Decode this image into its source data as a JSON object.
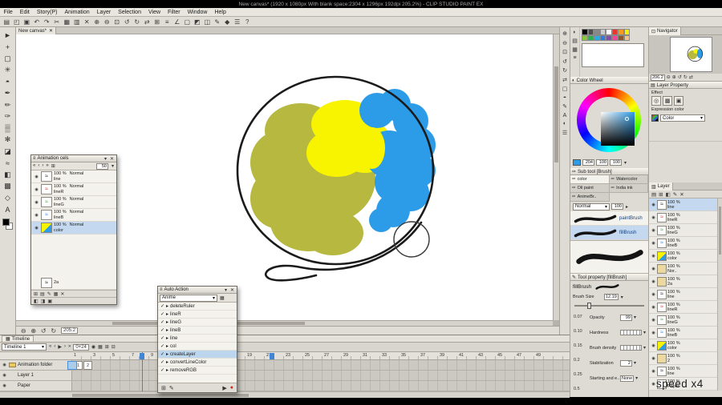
{
  "window": {
    "title": "New canvas* (1920 x 1080px With blank space:2304 x 1296px 192dpi 205.2%) - CLIP STUDIO PAINT EX"
  },
  "colors": {
    "olive": "#b6b83f",
    "yellow": "#f8f400",
    "blue": "#2d9ce8",
    "selection_blue": "#bcd6ee",
    "marker_blue": "#3f86d8"
  },
  "menubar": {
    "items": [
      {
        "label": "File"
      },
      {
        "label": "Edit"
      },
      {
        "label": "Story(P)"
      },
      {
        "label": "Animation"
      },
      {
        "label": "Layer"
      },
      {
        "label": "Selection"
      },
      {
        "label": "View"
      },
      {
        "label": "Filter"
      },
      {
        "label": "Window"
      },
      {
        "label": "Help"
      }
    ]
  },
  "toolbar": {
    "icons": [
      {
        "name": "new-canvas-icon",
        "glyph": "▤"
      },
      {
        "name": "open-icon",
        "glyph": "◰"
      },
      {
        "name": "save-icon",
        "glyph": "▣"
      },
      {
        "name": "undo-icon",
        "glyph": "↶"
      },
      {
        "name": "redo-icon",
        "glyph": "↷"
      },
      {
        "name": "cut-icon",
        "glyph": "✂"
      },
      {
        "name": "copy-icon",
        "glyph": "▦"
      },
      {
        "name": "paste-icon",
        "glyph": "▥"
      },
      {
        "name": "delete-icon",
        "glyph": "✕"
      },
      {
        "name": "zoom-in-icon",
        "glyph": "⊕"
      },
      {
        "name": "zoom-out-icon",
        "glyph": "⊖"
      },
      {
        "name": "fit-screen-icon",
        "glyph": "⊡"
      },
      {
        "name": "rotate-left-icon",
        "glyph": "↺"
      },
      {
        "name": "rotate-right-icon",
        "glyph": "↻"
      },
      {
        "name": "flip-horizontal-icon",
        "glyph": "⇄"
      },
      {
        "name": "grid-icon",
        "glyph": "⊞"
      },
      {
        "name": "snap-ruler-icon",
        "glyph": "≡"
      },
      {
        "name": "snap-special-ruler-icon",
        "glyph": "∠"
      },
      {
        "name": "select-none-icon",
        "glyph": "▢"
      },
      {
        "name": "invert-selection-icon",
        "glyph": "◩"
      },
      {
        "name": "selection-border-icon",
        "glyph": "◫"
      },
      {
        "name": "pen-settings-icon",
        "glyph": "✎"
      },
      {
        "name": "material-icon",
        "glyph": "◆"
      },
      {
        "name": "launcher-icon",
        "glyph": "☰"
      },
      {
        "name": "help-icon",
        "glyph": "?"
      }
    ]
  },
  "tools": {
    "items": [
      {
        "name": "operation-tool-icon",
        "glyph": "►"
      },
      {
        "name": "move-tool-icon",
        "glyph": "+"
      },
      {
        "name": "marquee-tool-icon",
        "glyph": "▢"
      },
      {
        "name": "auto-select-tool-icon",
        "glyph": "✳"
      },
      {
        "name": "eyedropper-tool-icon",
        "glyph": "◓"
      },
      {
        "name": "pen-tool-icon",
        "glyph": "✒"
      },
      {
        "name": "pencil-tool-icon",
        "glyph": "✏"
      },
      {
        "name": "brush-tool-icon",
        "glyph": "✑"
      },
      {
        "name": "airbrush-tool-icon",
        "glyph": "▒"
      },
      {
        "name": "decoration-tool-icon",
        "glyph": "✻"
      },
      {
        "name": "eraser-tool-icon",
        "glyph": "◪"
      },
      {
        "name": "blend-tool-icon",
        "glyph": "≈"
      },
      {
        "name": "fill-tool-icon",
        "glyph": "◧"
      },
      {
        "name": "gradient-tool-icon",
        "glyph": "▩"
      },
      {
        "name": "figure-tool-icon",
        "glyph": "◇"
      },
      {
        "name": "text-tool-icon",
        "glyph": "A"
      }
    ]
  },
  "side_tools": {
    "items": [
      {
        "name": "zoom-in-icon",
        "glyph": "⊕"
      },
      {
        "name": "zoom-out-icon",
        "glyph": "⊖"
      },
      {
        "name": "fit-icon",
        "glyph": "⊡"
      },
      {
        "name": "rotate-ccw-icon",
        "glyph": "↺"
      },
      {
        "name": "rotate-cw-icon",
        "glyph": "↻"
      },
      {
        "name": "flip-icon",
        "glyph": "⇄"
      },
      {
        "name": "reset-view-icon",
        "glyph": "▢"
      },
      {
        "name": "eyedropper-icon",
        "glyph": "◓"
      },
      {
        "name": "pen-icon",
        "glyph": "✎"
      },
      {
        "name": "text-icon",
        "glyph": "A"
      },
      {
        "name": "tone-icon",
        "glyph": "◐"
      },
      {
        "name": "menu-icon",
        "glyph": "☰"
      }
    ]
  },
  "canvas": {
    "tab_label": "New canvas*",
    "close": "✕",
    "status_zoom": "205.2",
    "status_icons": [
      {
        "name": "zoom-out-icon",
        "glyph": "⊖"
      },
      {
        "name": "zoom-in-icon",
        "glyph": "⊕"
      },
      {
        "name": "rotate-ccw-icon",
        "glyph": "↺"
      },
      {
        "name": "rotate-cw-icon",
        "glyph": "↻"
      }
    ]
  },
  "swatches": {
    "side_icons": [
      {
        "name": "color-wheel-icon",
        "glyph": "◐"
      },
      {
        "name": "color-set-icon",
        "glyph": "▤"
      },
      {
        "name": "mixing-icon",
        "glyph": "▦"
      },
      {
        "name": "history-icon",
        "glyph": "≡"
      }
    ],
    "colors": [
      "#000000",
      "#4d4d4d",
      "#888888",
      "#cccccc",
      "#ffffff",
      "#e8372c",
      "#f59b22",
      "#f6ef0c",
      "#8bc53f",
      "#2bb24c",
      "#29abe2",
      "#2b7de0",
      "#7b52a8",
      "#ed4996",
      "#8b5a2b",
      "#f2c28c"
    ]
  },
  "color_wheel": {
    "title": "Color Wheel"
  },
  "color_values": {
    "values": [
      "204",
      "100",
      "100"
    ]
  },
  "sub_tool": {
    "title": "Sub tool [Brush]",
    "tabs": [
      {
        "label": "color",
        "active": true
      },
      {
        "label": "Watercolor"
      },
      {
        "label": "Oil paint"
      },
      {
        "label": "India ink"
      },
      {
        "label": "AnimeBr.."
      }
    ]
  },
  "blend": {
    "mode": "Normal",
    "value": "100"
  },
  "brushes": {
    "items": [
      {
        "name": "paintBrush"
      },
      {
        "name": "fillBrush",
        "selected": true
      }
    ]
  },
  "tool_property": {
    "title": "Tool property [fillBrush]",
    "brush_name": "fillBrush",
    "brush_size": {
      "label": "Brush Size",
      "value": "12.19"
    },
    "mini_values": [
      "0.07",
      "0.10",
      "0.15",
      "0.2",
      "0.25",
      "0.5"
    ],
    "params": [
      {
        "label": "Opacity",
        "value": "99"
      },
      {
        "label": "Hardness",
        "value": "",
        "seg": true
      },
      {
        "label": "Brush density",
        "value": "",
        "seg": true
      },
      {
        "label": "Stabilization",
        "value": "2"
      },
      {
        "label": "Starting and e..",
        "value": "None"
      }
    ]
  },
  "navigator": {
    "title": "Navigator",
    "zoom": "206.2",
    "icons": [
      {
        "name": "zoom-out-icon",
        "glyph": "⊖"
      },
      {
        "name": "zoom-in-icon",
        "glyph": "⊕"
      },
      {
        "name": "rotate-ccw-icon",
        "glyph": "↺"
      },
      {
        "name": "rotate-cw-icon",
        "glyph": "↻"
      },
      {
        "name": "flip-icon",
        "glyph": "⇄"
      }
    ]
  },
  "layer_property": {
    "title": "Layer Property",
    "effect_label": "Effect",
    "effect_icons": [
      {
        "name": "border-effect-icon",
        "glyph": "◎"
      },
      {
        "name": "tone-effect-icon",
        "glyph": "▩"
      },
      {
        "name": "layer-color-effect-icon",
        "glyph": "▣"
      }
    ],
    "expression_label": "Expression color",
    "expression_value": "Color"
  },
  "layer_panel": {
    "tab": "Layer",
    "icons": [
      {
        "name": "new-layer-icon",
        "glyph": "▤"
      },
      {
        "name": "new-folder-icon",
        "glyph": "⊞"
      },
      {
        "name": "mask-icon",
        "glyph": "◧"
      },
      {
        "name": "edit-icon",
        "glyph": "✎"
      },
      {
        "name": "delete-layer-icon",
        "glyph": "✕"
      }
    ],
    "rows": [
      {
        "opacity": "100 %",
        "name": "line",
        "kind": "k",
        "selected": true
      },
      {
        "opacity": "100 %",
        "name": "lineR",
        "kind": "r"
      },
      {
        "opacity": "100 %",
        "name": "lineG",
        "kind": "g"
      },
      {
        "opacity": "100 %",
        "name": "lineB",
        "kind": "b"
      },
      {
        "opacity": "100 %",
        "name": "color",
        "kind": "c"
      },
      {
        "opacity": "100 %",
        "name": "Nor..",
        "kind": "f"
      },
      {
        "opacity": "100 %",
        "name": "2a",
        "kind": "f"
      },
      {
        "opacity": "100 %",
        "name": "line",
        "kind": "k"
      },
      {
        "opacity": "100 %",
        "name": "lineR",
        "kind": "r"
      },
      {
        "opacity": "100 %",
        "name": "lineG",
        "kind": "g"
      },
      {
        "opacity": "100 %",
        "name": "lineB",
        "kind": "b"
      },
      {
        "opacity": "100 %",
        "name": "color",
        "kind": "c"
      },
      {
        "opacity": "100 %",
        "name": "2",
        "kind": "f"
      },
      {
        "opacity": "100 %",
        "name": "line",
        "kind": "k"
      },
      {
        "opacity": "100 %",
        "name": "Paper",
        "kind": "w"
      }
    ]
  },
  "animation_cels": {
    "title": "Animation cels",
    "toolbar_icons": [
      {
        "name": "prev-cel-icon",
        "glyph": "«"
      },
      {
        "name": "prev-icon",
        "glyph": "‹"
      },
      {
        "name": "next-icon",
        "glyph": "›"
      },
      {
        "name": "next-cel-icon",
        "glyph": "»"
      },
      {
        "name": "light-table-icon",
        "glyph": "⊞"
      }
    ],
    "value": "50",
    "rows": [
      {
        "opacity": "100 %",
        "mode": "Normal",
        "name": "line",
        "kind": "k"
      },
      {
        "opacity": "100 %",
        "mode": "Normal",
        "name": "lineR",
        "kind": "r"
      },
      {
        "opacity": "100 %",
        "mode": "Normal",
        "name": "lineG",
        "kind": "g"
      },
      {
        "opacity": "100 %",
        "mode": "Normal",
        "name": "lineB",
        "kind": "b"
      },
      {
        "opacity": "100 %",
        "mode": "Normal",
        "name": "color",
        "kind": "c",
        "selected": true
      }
    ],
    "extra_row": {
      "name": "2a"
    },
    "footer_icons": [
      {
        "name": "register-cel-icon",
        "glyph": "⊞"
      },
      {
        "name": "new-cel-icon",
        "glyph": "▤"
      },
      {
        "name": "edit-cel-icon",
        "glyph": "✎"
      },
      {
        "name": "cel-settings-icon",
        "glyph": "▦"
      },
      {
        "name": "delete-cel-icon",
        "glyph": "✕"
      }
    ],
    "footer_icons2": [
      {
        "name": "onion-prev-icon",
        "glyph": "◧"
      },
      {
        "name": "onion-next-icon",
        "glyph": "◨"
      },
      {
        "name": "onion-settings-icon",
        "glyph": "▣"
      }
    ]
  },
  "auto_action": {
    "title": "Auto Action",
    "set_name": "Anime",
    "rows": [
      {
        "name": "deleteRuler"
      },
      {
        "name": "lineR"
      },
      {
        "name": "lineG"
      },
      {
        "name": "lineB"
      },
      {
        "name": "line"
      },
      {
        "name": "col"
      },
      {
        "name": "createLayer",
        "selected": true
      },
      {
        "name": "convertLineColor"
      },
      {
        "name": "removeRGB"
      }
    ],
    "footer_left": [
      {
        "name": "add-action-icon",
        "glyph": "⊞"
      },
      {
        "name": "record-settings-icon",
        "glyph": "✎"
      }
    ],
    "footer_right": [
      {
        "name": "play-action-icon",
        "glyph": "▶"
      },
      {
        "name": "record-action-icon",
        "glyph": "●",
        "red": true
      }
    ]
  },
  "timeline": {
    "tab": "Timeline",
    "name": "Timeline 1",
    "frame_label": "0+24",
    "transport": [
      {
        "name": "go-start-icon",
        "glyph": "«"
      },
      {
        "name": "prev-frame-icon",
        "glyph": "‹"
      },
      {
        "name": "play-icon",
        "glyph": "▶"
      },
      {
        "name": "next-frame-icon",
        "glyph": "›"
      },
      {
        "name": "go-end-icon",
        "glyph": "»"
      }
    ],
    "extra_icons": [
      {
        "name": "loop-icon",
        "glyph": "◉"
      },
      {
        "name": "onion-skin-icon",
        "glyph": "▦"
      },
      {
        "name": "new-track-icon",
        "glyph": "⊞"
      },
      {
        "name": "delete-track-icon",
        "glyph": "⊟"
      }
    ],
    "frames": [
      "1",
      "3",
      "5",
      "7",
      "9",
      "11",
      "13",
      "15",
      "17",
      "19",
      "21",
      "23",
      "25",
      "27",
      "29",
      "31",
      "33",
      "35",
      "37",
      "39",
      "41",
      "43",
      "45",
      "47",
      "49"
    ],
    "tracks": [
      {
        "name": "Animation folder",
        "folder": true
      },
      {
        "name": "Layer 1"
      },
      {
        "name": "Paper"
      }
    ],
    "cels": [
      "1",
      "2"
    ]
  },
  "overlay": {
    "speed": "speed x4"
  }
}
